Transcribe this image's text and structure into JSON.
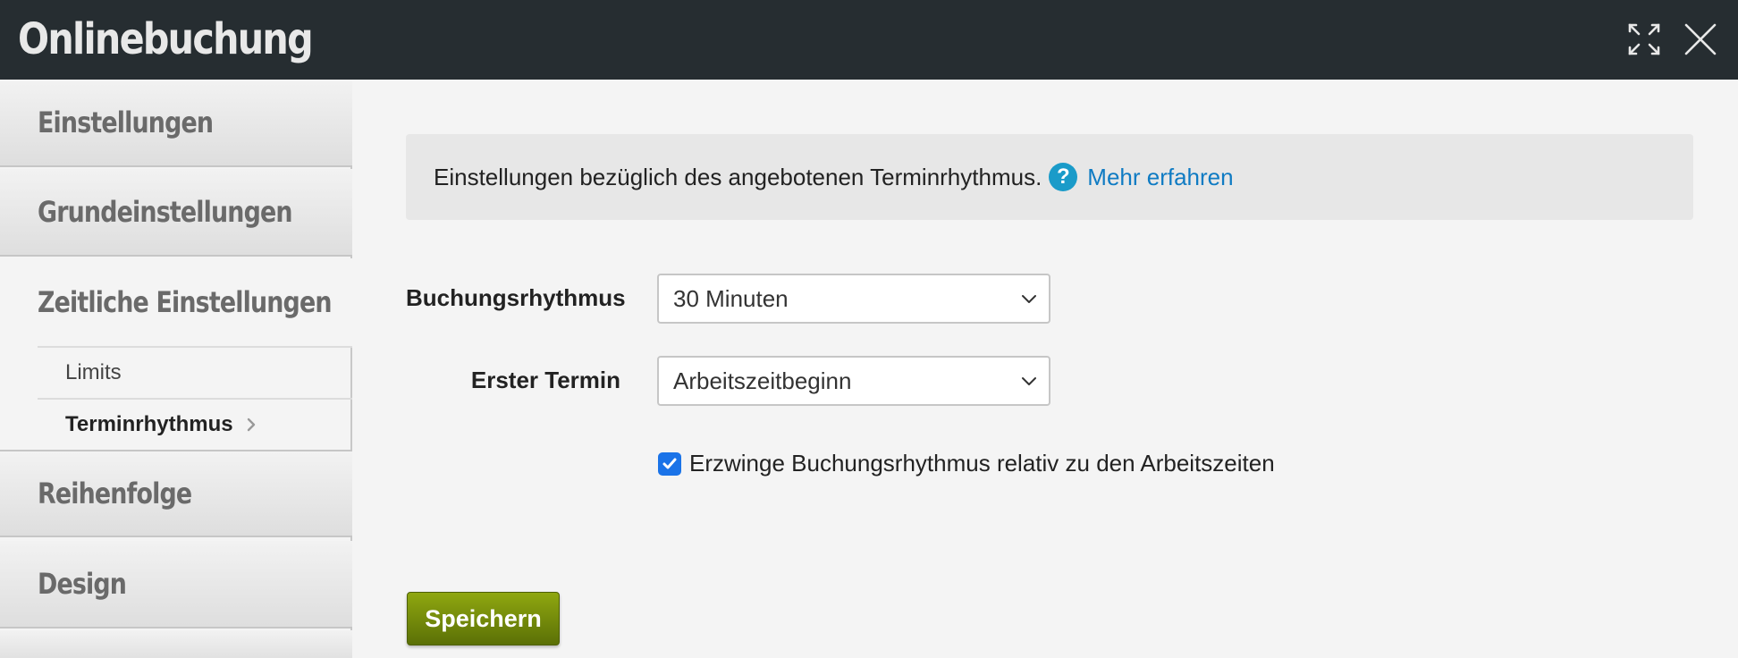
{
  "header": {
    "title": "Onlinebuchung"
  },
  "sidebar": {
    "items": [
      {
        "label": "Einstellungen"
      },
      {
        "label": "Grundeinstellungen"
      },
      {
        "label": "Zeitliche Einstellungen"
      },
      {
        "label": "Reihenfolge"
      },
      {
        "label": "Design"
      }
    ],
    "subitems": [
      {
        "label": "Limits"
      },
      {
        "label": "Terminrhythmus"
      }
    ]
  },
  "main": {
    "info_text": "Einstellungen bezüglich des angebotenen Terminrhythmus.",
    "help_glyph": "?",
    "info_link": "Mehr erfahren",
    "fields": [
      {
        "label": "Buchungsrhythmus",
        "value": "30 Minuten"
      },
      {
        "label": "Erster Termin",
        "value": "Arbeitszeitbeginn"
      }
    ],
    "checkbox": {
      "label": "Erzwinge Buchungsrhythmus relativ zu den Arbeitszeiten",
      "checked": true
    },
    "save_label": "Speichern"
  },
  "colors": {
    "header_bg": "#262d31",
    "link": "#0f7bc3",
    "help_icon": "#1a9bc9",
    "checkbox": "#1a73e8",
    "save_button": "#6e8a0a"
  },
  "icons": {
    "expand": "expand-icon",
    "close": "close-icon",
    "help": "help-icon",
    "chevron": "chevron-right-icon",
    "dropdown": "chevron-down-icon",
    "check": "checkmark-icon"
  }
}
